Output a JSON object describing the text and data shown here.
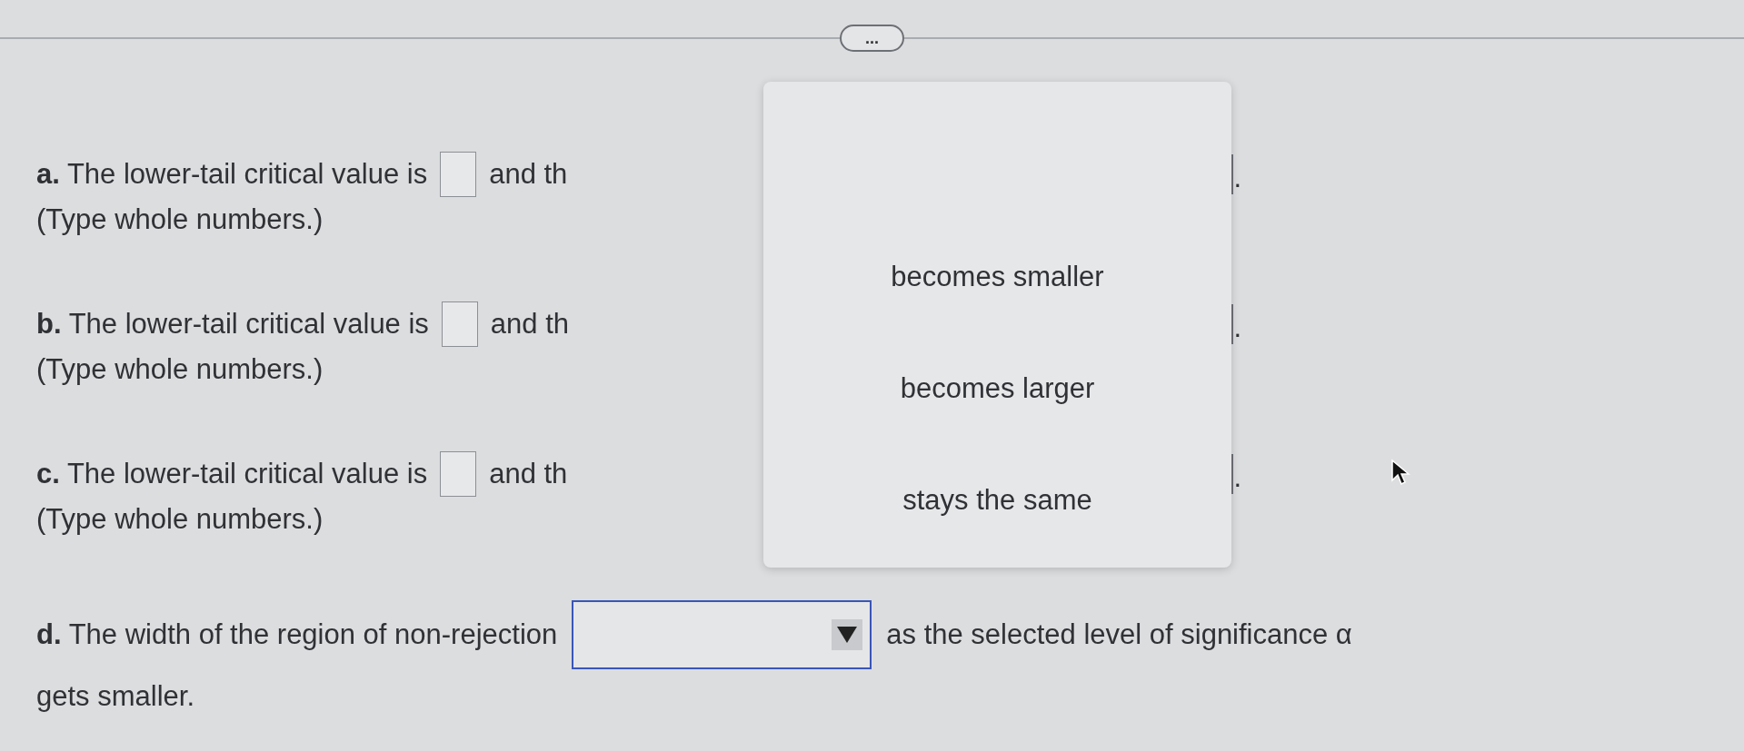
{
  "more_button": {
    "label": "..."
  },
  "parts": [
    {
      "letter": "a.",
      "text": "The lower-tail critical value is",
      "connector": "and th",
      "end": ".",
      "note": "(Type whole numbers.)"
    },
    {
      "letter": "b.",
      "text": "The lower-tail critical value is",
      "connector": "and th",
      "end": ".",
      "note": "(Type whole numbers.)"
    },
    {
      "letter": "c.",
      "text": "The lower-tail critical value is",
      "connector": "and th",
      "end": ".",
      "note": "(Type whole numbers.)"
    }
  ],
  "dropdown_menu": {
    "options": [
      {
        "label": "becomes smaller",
        "selected": false
      },
      {
        "label": "becomes larger",
        "selected": false
      },
      {
        "label": "stays the same",
        "selected": false
      }
    ]
  },
  "part_d": {
    "letter": "d.",
    "before": "The width of the region of non-rejection",
    "after": "as the selected level of significance α",
    "continuation": "gets smaller."
  }
}
